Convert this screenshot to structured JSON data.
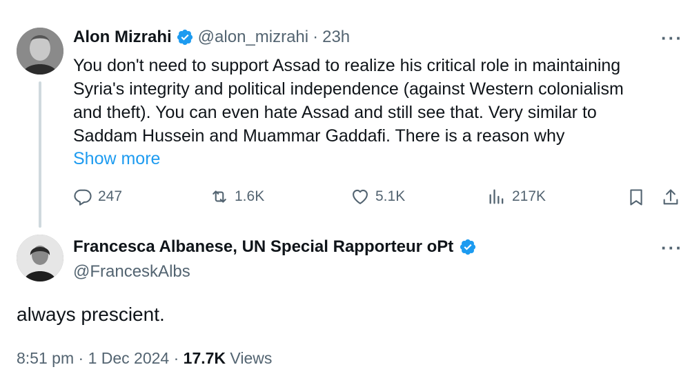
{
  "quoted_tweet": {
    "author_name": "Alon Mizrahi",
    "handle": "@alon_mizrahi",
    "separator": "·",
    "age": "23h",
    "text_lines": [
      "You don't need to support Assad to realize his critical role in maintaining",
      "Syria's integrity and political independence (against Western colonialism",
      "and theft). You can even hate Assad and still see that. Very similar to",
      "Saddam Hussein and Muammar Gaddafi. There is a reason why"
    ],
    "show_more": "Show more",
    "more_icon": "···",
    "stats": {
      "replies": "247",
      "reposts": "1.6K",
      "likes": "5.1K",
      "views": "217K"
    }
  },
  "reply_tweet": {
    "author_name": "Francesca Albanese, UN Special Rapporteur oPt",
    "handle": "@FranceskAlbs",
    "more_icon": "···",
    "text": "always prescient.",
    "time": "8:51 pm",
    "date": "1 Dec 2024",
    "dot": "·",
    "views_count": "17.7K",
    "views_label": "Views"
  },
  "colors": {
    "verified": "#1d9bf0",
    "link": "#1d9bf0",
    "secondary_text": "#536471",
    "thread_line": "#cfd9de"
  },
  "icons": [
    "verified-badge-icon",
    "reply-icon",
    "repost-icon",
    "like-icon",
    "views-icon",
    "bookmark-icon",
    "share-icon",
    "more-icon"
  ]
}
